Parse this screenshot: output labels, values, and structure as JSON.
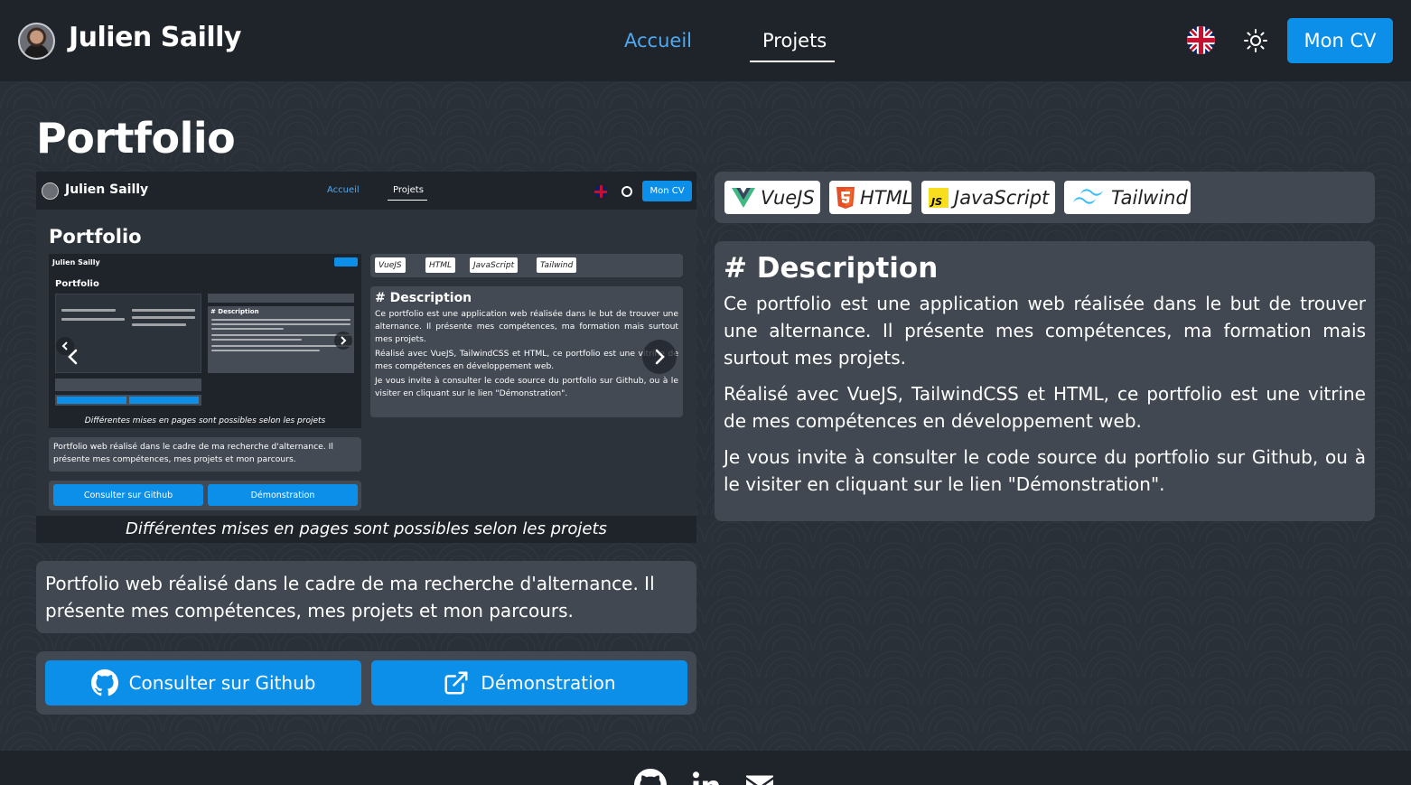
{
  "header": {
    "brand": "Julien Sailly",
    "nav": {
      "home": "Accueil",
      "projects": "Projets"
    },
    "cv_label": "Mon CV",
    "icons": {
      "language": "uk-flag-icon",
      "theme": "sun-icon"
    }
  },
  "colors": {
    "accent": "#0b8fe8",
    "nav_active": "#4fa8f0",
    "bg": "#2a3038",
    "header_bg": "#1f242b"
  },
  "project": {
    "title": "Portfolio",
    "caption": "Différentes mises en pages sont possibles selon les projets",
    "summary": "Portfolio web réalisé dans le cadre de ma recherche d'alternance. Il présente mes compétences, mes projets et mon parcours.",
    "github_label": "Consulter sur Github",
    "demo_label": "Démonstration",
    "tags": [
      "VueJS",
      "HTML",
      "JavaScript",
      "Tailwind"
    ],
    "description": {
      "title": "# Description",
      "paragraphs": [
        "Ce portfolio est une application web réalisée dans le but de trouver une alternance. Il présente mes compétences, ma formation mais surtout mes projets.",
        "Réalisé avec VueJS, TailwindCSS et HTML, ce portfolio est une vitrine de mes compétences en développement web.",
        "Je vous invite à consulter le code source du portfolio sur Github, ou à le visiter en cliquant sur le lien \"Démonstration\"."
      ]
    }
  },
  "footer": {
    "icons": [
      "github-icon",
      "linkedin-icon",
      "mail-icon"
    ]
  }
}
